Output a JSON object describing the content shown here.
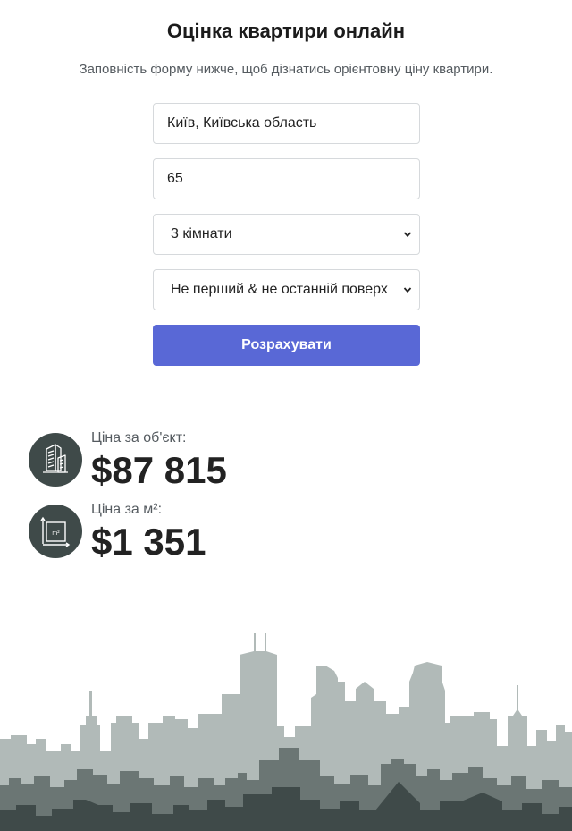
{
  "page": {
    "title": "Оцінка квартири онлайн",
    "subtitle": "Заповність форму нижче, щоб дізнатись орієнтовну ціну квартири."
  },
  "form": {
    "location_value": "Київ, Київська область",
    "area_value": "65",
    "rooms_selected": "3 кімнати",
    "floor_selected": "Не перший & не останній поверх",
    "submit_label": "Розрахувати",
    "button_color": "#5968d6"
  },
  "results": {
    "object_price_label": "Ціна за об'єкт:",
    "object_price_value": "$87 815",
    "object_price_icon": "buildings-icon",
    "sqm_price_label": "Ціна за м²:",
    "sqm_price_value": "$1 351",
    "sqm_price_icon": "square-meter-icon"
  },
  "colors": {
    "icon_circle": "#3f4a49",
    "skyline_back": "#b1bab8",
    "skyline_mid": "#6b7674",
    "skyline_front": "#3f4a49"
  }
}
